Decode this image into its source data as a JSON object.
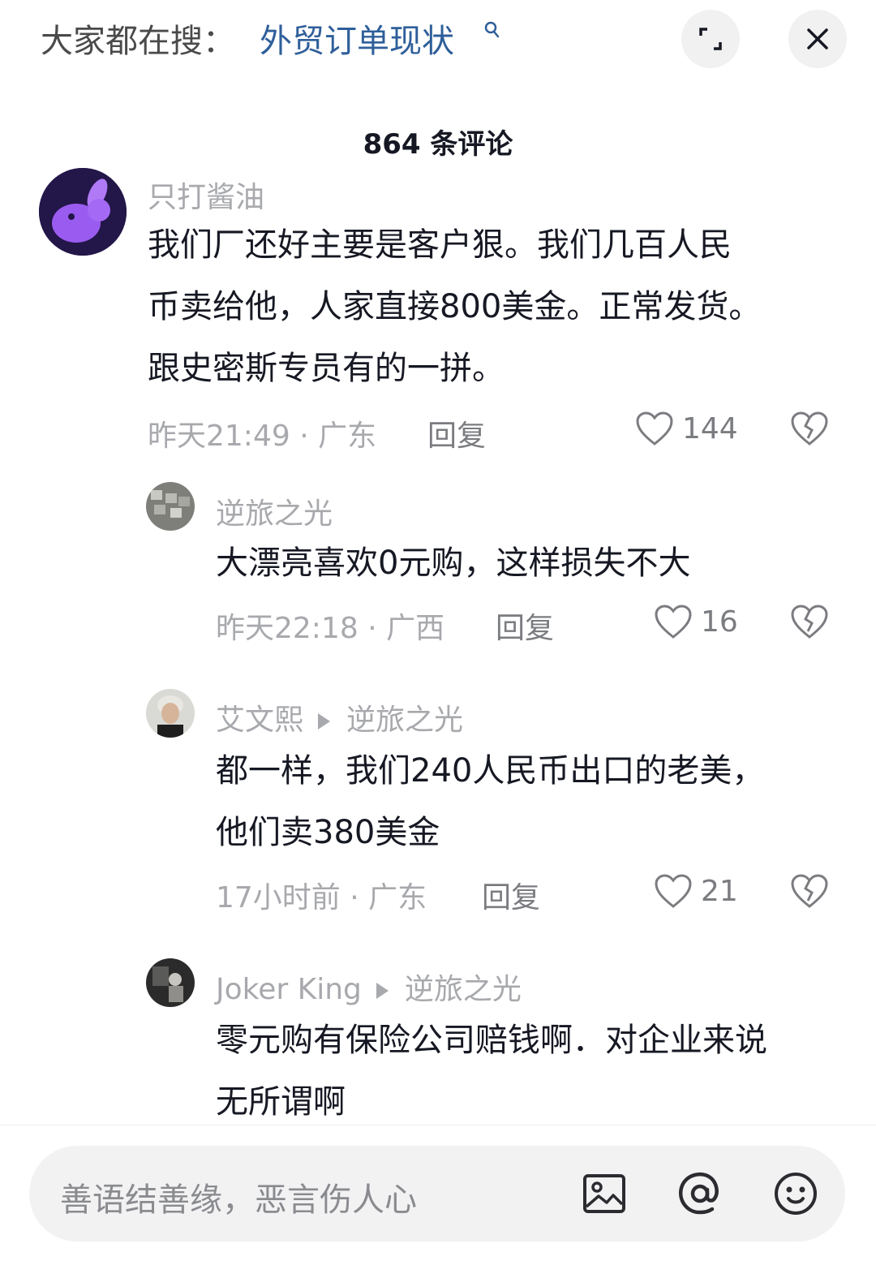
{
  "top_bar": {
    "hot_prefix": "大家都在搜：",
    "hot_term": "外贸订单现状",
    "hot_icon": "search-icon",
    "expand_icon": "expand-icon",
    "close_icon": "close-icon"
  },
  "comment_count": "864 条评论",
  "comments": [
    {
      "user": "只打酱油",
      "text_lines": [
        "我们厂还好主要是客户狠。我们几百人民",
        "币卖给他，人家直接800美金。正常发货。",
        "跟史密斯专员有的一拼。"
      ],
      "meta": "昨天21:49 · 广东",
      "reply_label": "回复",
      "likes": "144"
    },
    {
      "user": "逆旅之光",
      "text_lines": [
        "大漂亮喜欢0元购，这样损失不大"
      ],
      "meta": "昨天22:18 · 广西",
      "reply_label": "回复",
      "likes": "16"
    },
    {
      "user": "艾文熙",
      "reply_to": "逆旅之光",
      "text_lines": [
        "都一样，我们240人民币出口的老美，",
        "他们卖380美金"
      ],
      "meta": "17小时前 · 广东",
      "reply_label": "回复",
      "likes": "21"
    },
    {
      "user": "Joker King",
      "reply_to": "逆旅之光",
      "text_lines": [
        "零元购有保险公司赔钱啊．对企业来说",
        "无所谓啊"
      ]
    }
  ],
  "input": {
    "placeholder": "善语结善缘，恶言伤人心",
    "icons": [
      "image-icon",
      "at-icon",
      "emoji-icon"
    ]
  },
  "colors": {
    "hot_term": "#2f5f9a",
    "secondary_text": "#a8a9ad",
    "primary_text": "#161823"
  }
}
